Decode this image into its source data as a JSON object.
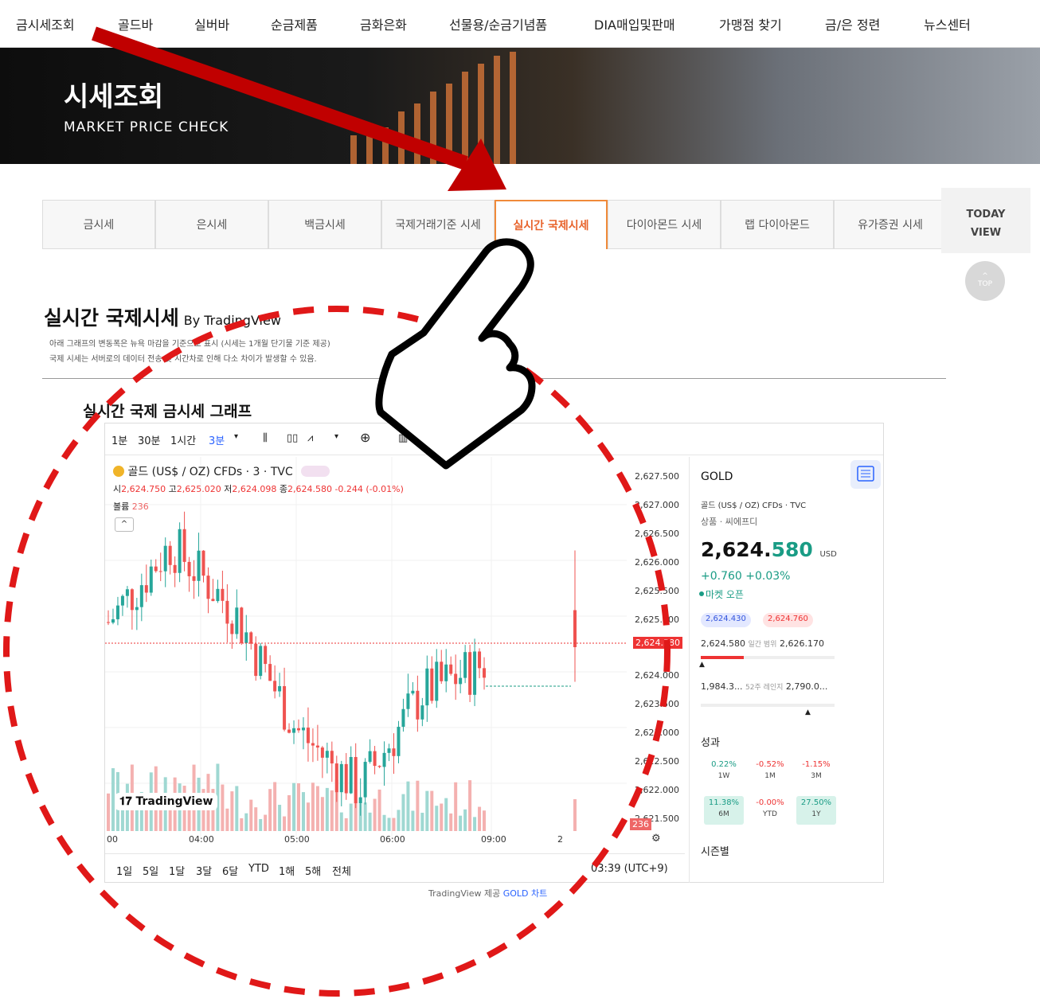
{
  "topnav": [
    "금시세조회",
    "골드바",
    "실버바",
    "순금제품",
    "금화은화",
    "선물용/순금기념품",
    "DIA매입및판매",
    "가맹점 찾기",
    "금/은 정련",
    "뉴스센터"
  ],
  "hero": {
    "title": "시세조회",
    "subtitle": "MARKET PRICE CHECK"
  },
  "tabs": [
    "금시세",
    "은시세",
    "백금시세",
    "국제거래기준 시세",
    "실시간 국제시세",
    "다이아몬드 시세",
    "랩 다이아몬드",
    "유가증권 시세"
  ],
  "active_tab": "실시간 국제시세",
  "today_view": {
    "line1": "TODAY",
    "line2": "VIEW"
  },
  "top_button": "TOP",
  "section": {
    "title": "실시간 국제시세",
    "by": "By TradingView",
    "desc1": "아래 그래프의 변동폭은 뉴욕 마감을 기준으로 표시 (시세는 1개월 단기물 기준 제공)",
    "desc2": "국제 시세는 서버로의 데이터 전송 및 시간차로 인해 다소 차이가 발생할 수 있음.",
    "graph_title": "실시간 국제 금시세 그래프"
  },
  "toolbar": {
    "intervals": [
      "1분",
      "30분",
      "1시간",
      "3분"
    ],
    "active_interval": "3분"
  },
  "chart": {
    "symbol": "골드 (US$ / OZ) CFDs · 3 · TVC",
    "ohlc": {
      "o_label": "시",
      "o": "2,624.750",
      "h_label": "고",
      "h": "2,625.020",
      "l_label": "저",
      "l": "2,624.098",
      "c_label": "종",
      "c": "2,624.580",
      "chg": "-0.244 (-0.01%)"
    },
    "volume_label": "볼륨",
    "volume": "236",
    "price_ticks": [
      "2,627.500",
      "2,627.000",
      "2,626.500",
      "2,626.000",
      "2,625.500",
      "2,625.000",
      "2,624.000",
      "2,623.500",
      "2,623.000",
      "2,622.500",
      "2,622.000",
      "2,621.500"
    ],
    "current_price_tag": "2,624.580",
    "volume_tag": "236",
    "time_ticks": [
      "00",
      "04:00",
      "05:00",
      "06:00",
      "09:00",
      "2"
    ],
    "logo": "TradingView",
    "ranges": [
      "1일",
      "5일",
      "1달",
      "3달",
      "6달",
      "YTD",
      "1해",
      "5해",
      "전체"
    ],
    "clock": "03:39 (UTC+9)"
  },
  "chart_data": {
    "type": "candlestick",
    "title": "골드 (US$ / OZ) CFDs · 3 · TVC",
    "ylim": [
      2621.5,
      2627.5
    ],
    "x": [
      "00",
      "04:00",
      "05:00",
      "06:00",
      "09:00",
      "2"
    ],
    "series": [
      {
        "name": "골드",
        "values": [
          2625.0,
          2626.3,
          2625.2,
          2623.2,
          2622.2,
          2623.8,
          2624.3,
          2624.58
        ]
      }
    ],
    "last": 2624.58
  },
  "side": {
    "ticker": "GOLD",
    "name": "골드 (US$ / OZ) CFDs · TVC",
    "category": "상품 · 씨에프디",
    "price_main": "2,624.",
    "price_hi": "580",
    "currency": "USD",
    "change": "+0.760  +0.03%",
    "market": "마켓 오픈",
    "bid": "2,624.430",
    "ask": "2,624.760",
    "day_low": "2,624.580",
    "day_label": "일간 범위",
    "day_high": "2,626.170",
    "w52_low": "1,984.3...",
    "w52_label": "52주 레인지",
    "w52_high": "2,790.0...",
    "perf_title": "성과",
    "perf": [
      {
        "v": "0.22%",
        "l": "1W",
        "c": "#1a9c85",
        "bg": "#fff"
      },
      {
        "v": "-0.52%",
        "l": "1M",
        "c": "#e33",
        "bg": "#fff"
      },
      {
        "v": "-1.15%",
        "l": "3M",
        "c": "#e33",
        "bg": "#fff"
      },
      {
        "v": "11.38%",
        "l": "6M",
        "c": "#1a9c85",
        "bg": "#d7f2ea"
      },
      {
        "v": "-0.00%",
        "l": "YTD",
        "c": "#e33",
        "bg": "#fff"
      },
      {
        "v": "27.50%",
        "l": "1Y",
        "c": "#1a9c85",
        "bg": "#d7f2ea"
      }
    ],
    "season": "시즌별"
  },
  "credit": {
    "prefix": "TradingView 제공 ",
    "link": "GOLD 차트"
  }
}
